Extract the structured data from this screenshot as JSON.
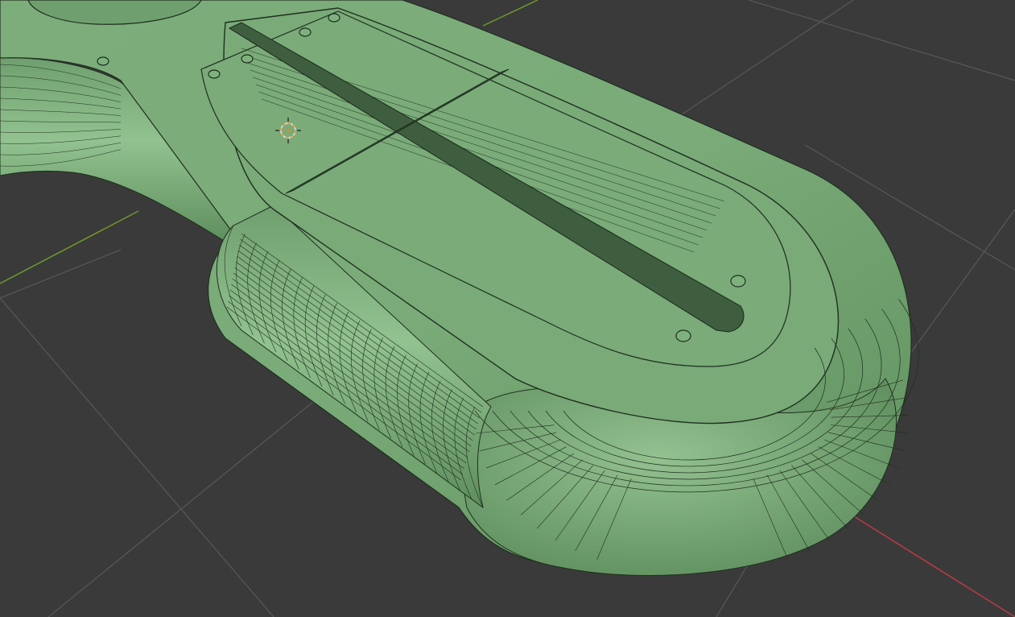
{
  "app": {
    "view": "3d-viewport",
    "shading_mode": "solid-wireframe-overlay"
  },
  "colors": {
    "background": "#3a3a3a",
    "grid_line": "#5b5b5b",
    "x_axis": "#b83a47",
    "y_axis": "#6f9a2a",
    "mesh_fill": "#78a877",
    "mesh_fill_light": "#8dbc8a",
    "mesh_fill_dark": "#5f8f5e",
    "wire": "#1f2f1f",
    "cursor_ring": "#e7a24a",
    "cursor_dash": "#d8d8d8"
  },
  "viewport": {
    "grid_visible": true,
    "axes_visible": [
      "x",
      "y"
    ]
  },
  "objects": [
    {
      "type": "mesh",
      "name_visible": false,
      "icon": "mesh-object-icon"
    },
    {
      "type": "3d-cursor",
      "icon": "3d-cursor-icon"
    }
  ]
}
